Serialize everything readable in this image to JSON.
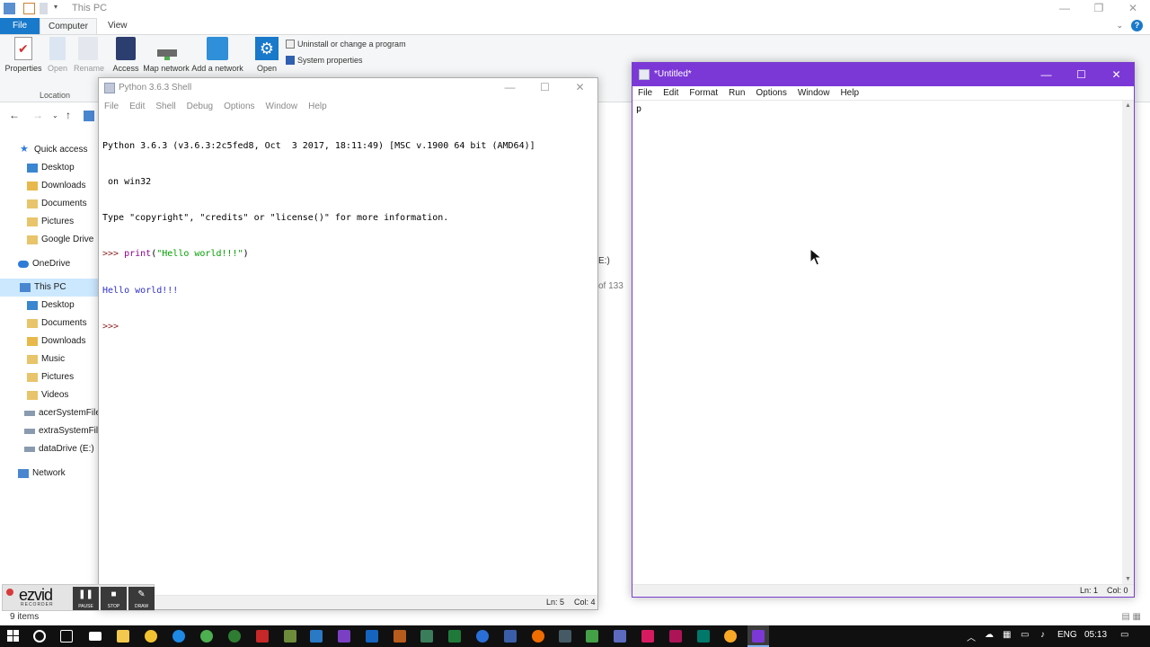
{
  "explorer": {
    "title": "This PC",
    "tabs": [
      "File",
      "Computer",
      "View"
    ],
    "ribbon": {
      "properties": "Properties",
      "open": "Open",
      "rename": "Rename",
      "access": "Access",
      "map_network": "Map network",
      "add_network": "Add a network",
      "open2": "Open",
      "uninstall": "Uninstall or change a program",
      "system_properties": "System properties",
      "group_location": "Location"
    },
    "nav": [
      {
        "label": "Quick access",
        "icon": "star-icon"
      },
      {
        "label": "Desktop",
        "icon": "folder-icon"
      },
      {
        "label": "Downloads",
        "icon": "download-folder-icon"
      },
      {
        "label": "Documents",
        "icon": "documents-folder-icon"
      },
      {
        "label": "Pictures",
        "icon": "pictures-folder-icon"
      },
      {
        "label": "Google Drive",
        "icon": "google-drive-folder-icon"
      },
      {
        "label": "OneDrive",
        "icon": "cloud-icon"
      },
      {
        "label": "This PC",
        "icon": "computer-icon"
      },
      {
        "label": "Desktop",
        "icon": "folder-icon"
      },
      {
        "label": "Documents",
        "icon": "documents-folder-icon"
      },
      {
        "label": "Downloads",
        "icon": "download-folder-icon"
      },
      {
        "label": "Music",
        "icon": "music-folder-icon"
      },
      {
        "label": "Pictures",
        "icon": "pictures-folder-icon"
      },
      {
        "label": "Videos",
        "icon": "videos-folder-icon"
      },
      {
        "label": "acerSystemFile",
        "icon": "drive-icon"
      },
      {
        "label": "extraSystemFile",
        "icon": "drive-icon"
      },
      {
        "label": "dataDrive (E:)",
        "icon": "drive-icon"
      },
      {
        "label": "Network",
        "icon": "network-icon"
      }
    ],
    "peek_drive": "E:)",
    "peek_size": "of 133",
    "status_items": "9 items"
  },
  "shell": {
    "title": "Python 3.6.3 Shell",
    "menu": [
      "File",
      "Edit",
      "Shell",
      "Debug",
      "Options",
      "Window",
      "Help"
    ],
    "banner_line1": "Python 3.6.3 (v3.6.3:2c5fed8, Oct  3 2017, 18:11:49) [MSC v.1900 64 bit (AMD64)]",
    "banner_line2": " on win32",
    "banner_line3": "Type \"copyright\", \"credits\" or \"license()\" for more information.",
    "prompt": ">>> ",
    "cmd_builtin": "print",
    "cmd_open": "(",
    "cmd_string": "\"Hello world!!!\"",
    "cmd_close": ")",
    "output": "Hello world!!!",
    "prompt2": ">>>",
    "status_ln": "Ln: 5",
    "status_col": "Col: 4"
  },
  "editor": {
    "title": "*Untitled*",
    "menu": [
      "File",
      "Edit",
      "Format",
      "Run",
      "Options",
      "Window",
      "Help"
    ],
    "content": "p",
    "status_ln": "Ln: 1",
    "status_col": "Col: 0"
  },
  "ezvid": {
    "logo": "ezvid",
    "sub": "RECORDER",
    "pause": "PAUSE",
    "stop": "STOP",
    "draw": "DRAW"
  },
  "taskbar": {
    "lang": "ENG",
    "clock": "05:13"
  },
  "colors": {
    "editor_titlebar": "#7c38d6",
    "explorer_accent": "#1979ca",
    "prompt": "#8b1f1f",
    "builtin": "#900090",
    "string": "#00a000",
    "output": "#3030c8"
  }
}
